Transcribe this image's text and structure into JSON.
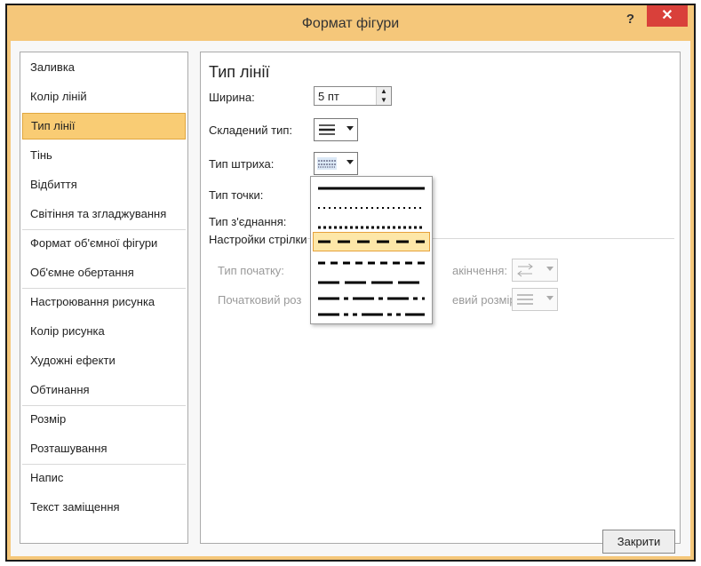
{
  "window": {
    "title": "Формат фігури",
    "help": "?",
    "close": "✕"
  },
  "nav": {
    "items": [
      {
        "label": "Заливка"
      },
      {
        "label": "Колір ліній"
      },
      {
        "label": "Тип лінії"
      },
      {
        "label": "Тінь"
      },
      {
        "label": "Відбиття"
      },
      {
        "label": "Світіння та згладжування"
      },
      {
        "label": "Формат об'ємної фігури"
      },
      {
        "label": "Об'ємне обертання"
      },
      {
        "label": "Настроювання рисунка"
      },
      {
        "label": "Колір рисунка"
      },
      {
        "label": "Художні ефекти"
      },
      {
        "label": "Обтинання"
      },
      {
        "label": "Розмір"
      },
      {
        "label": "Розташування"
      },
      {
        "label": "Напис"
      },
      {
        "label": "Текст заміщення"
      }
    ],
    "selected": "Тип лінії"
  },
  "panel": {
    "heading": "Тип лінії",
    "width_label": "Ширина:",
    "width_value": "5 пт",
    "compound_label": "Складений тип:",
    "dash_label": "Тип штриха:",
    "cap_label": "Тип точки:",
    "join_label": "Тип з'єднання:",
    "arrow_section": "Настройки стрілки",
    "begin_type_label": "Тип початку:",
    "end_type_label": "акінчення:",
    "begin_size_label": "Початковий роз",
    "end_size_label": "евий розмір:"
  },
  "dash_options": [
    "solid",
    "round-dot",
    "square-dot",
    "dash",
    "dash-dot",
    "long-dash",
    "long-dash-dot",
    "long-dash-dot-dot"
  ],
  "dash_selected": "dash",
  "footer": {
    "close_button": "Закрити"
  },
  "colors": {
    "accent": "#f9cc74",
    "close": "#d9403a"
  }
}
